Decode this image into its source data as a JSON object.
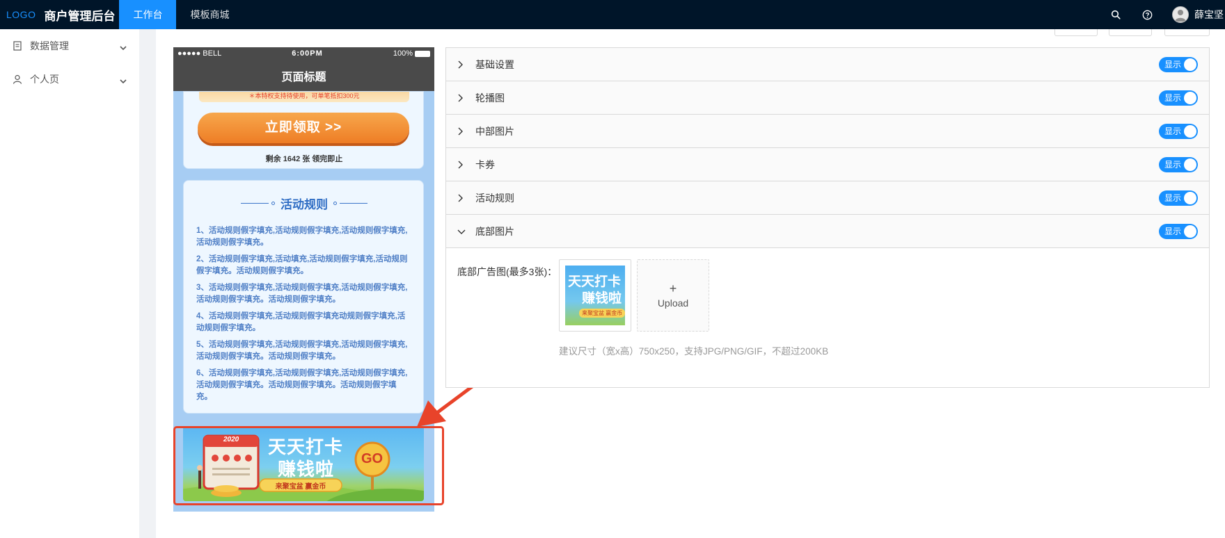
{
  "header": {
    "logo": "LOGO",
    "app_title": "商户管理后台",
    "tabs": [
      {
        "label": "工作台",
        "active": true
      },
      {
        "label": "模板商城",
        "active": false
      }
    ],
    "user_name": "薛宝坚",
    "accent_color": "#1890ff",
    "bg_color": "#001529"
  },
  "sidebar": {
    "items": [
      {
        "label": "数据管理",
        "icon": "file-icon"
      },
      {
        "label": "个人页",
        "icon": "user-icon"
      }
    ]
  },
  "phone": {
    "status": {
      "carrier": "●●●●● BELL",
      "time": "6:00PM",
      "battery": "100%"
    },
    "title": "页面标题",
    "coupon_strip": "＊本特权支持待使用，可单笔抵扣300元",
    "claim_button": "立即领取 >>",
    "remain_text": "剩余 1642 张 领完即止",
    "rules_title": "活动规则",
    "rules": [
      "1、活动规则假字填充,活动规则假字填充,活动规则假字填充,活动规则假字填充。",
      "2、活动规则假字填充,活动填充,活动规则假字填充,活动规则假字填充。活动规则假字填充。",
      "3、活动规则假字填充,活动规则假字填充,活动规则假字填充,活动规则假字填充。活动规则假字填充。",
      "4、活动规则假字填充,活动规则假字填充动规则假字填充,活动规则假字填充。",
      "5、活动规则假字填充,活动规则假字填充,活动规则假字填充,活动规则假字填充。活动规则假字填充。",
      "6、活动规则假字填充,活动规则假字填充,活动规则假字填充,活动规则假字填充。活动规则假字填充。活动规则假字填充。"
    ],
    "banner": {
      "year": "2020",
      "line1": "天天打卡",
      "line2": "赚钱啦",
      "go": "GO",
      "tagline": "来聚宝盆 赢金币"
    }
  },
  "panel": {
    "sections": [
      {
        "label": "基础设置",
        "toggle": "显示",
        "expanded": false
      },
      {
        "label": "轮播图",
        "toggle": "显示",
        "expanded": false
      },
      {
        "label": "中部图片",
        "toggle": "显示",
        "expanded": false
      },
      {
        "label": "卡券",
        "toggle": "显示",
        "expanded": false
      },
      {
        "label": "活动规则",
        "toggle": "显示",
        "expanded": false
      },
      {
        "label": "底部图片",
        "toggle": "显示",
        "expanded": true
      }
    ],
    "upload_label": "底部广告图(最多3张)：",
    "thumb_text_1": "天天打卡",
    "thumb_text_2": "赚钱啦",
    "thumb_tag": "来聚宝盆 赢金币",
    "upload_plus": "+",
    "upload_text": "Upload",
    "hint": "建议尺寸（宽x高）750x250，支持JPG/PNG/GIF，不超过200KB"
  },
  "highlight_color": "#e8432a"
}
